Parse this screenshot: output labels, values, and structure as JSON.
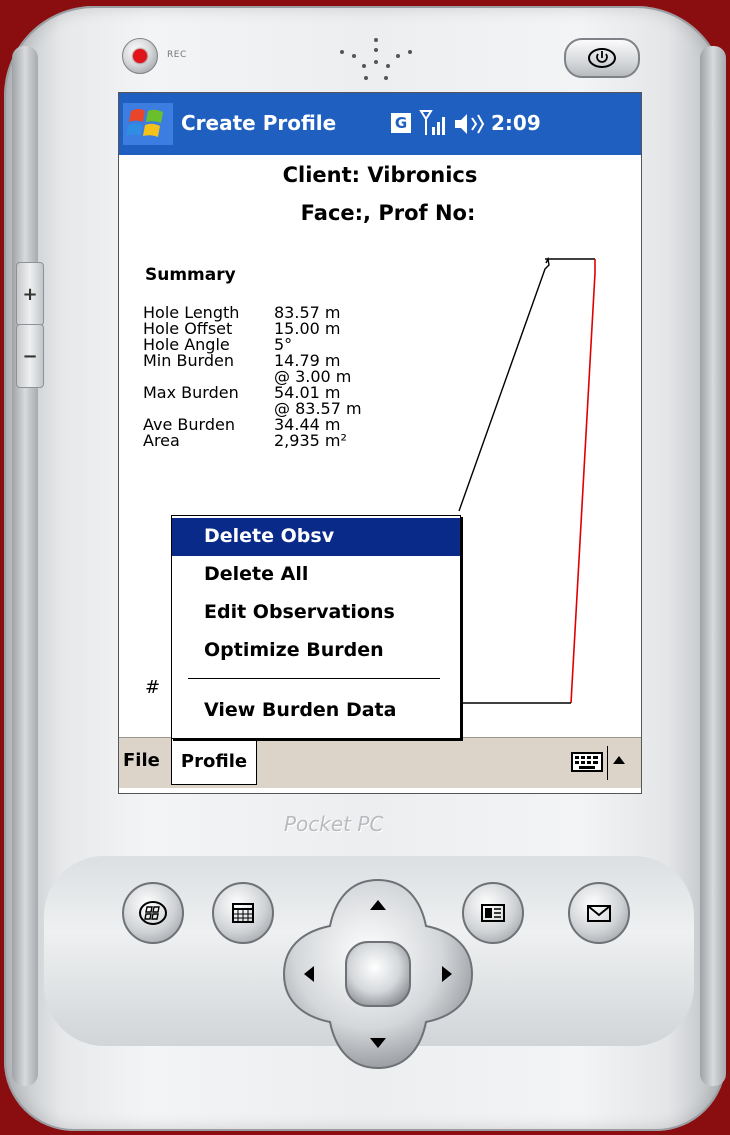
{
  "device": {
    "rec_label": "REC",
    "side_plus": "+",
    "side_minus": "−",
    "brand_label": "Pocket PC"
  },
  "taskbar": {
    "title": "Create Profile",
    "g_icon_label": "G",
    "time": "2:09",
    "icons": [
      "windows-start-icon",
      "g-icon",
      "signal-icon",
      "volume-icon"
    ]
  },
  "header": {
    "client": "Client: Vibronics",
    "face": "Face:, Prof No:"
  },
  "summary": {
    "title": "Summary",
    "rows": [
      {
        "label": "Hole Length",
        "value": "83.57 m"
      },
      {
        "label": "Hole Offset",
        "value": "15.00 m"
      },
      {
        "label": "Hole Angle",
        "value": "5°"
      },
      {
        "label": "Min Burden",
        "value": "14.79 m"
      },
      {
        "label": "",
        "value": " @ 3.00 m"
      },
      {
        "label": "Max Burden",
        "value": "54.01 m"
      },
      {
        "label": "",
        "value": " @ 83.57 m"
      },
      {
        "label": "Ave Burden",
        "value": "34.44 m"
      },
      {
        "label": "Area",
        "value": "2,935 m²"
      }
    ]
  },
  "hash_label": "#",
  "popup_menu": {
    "items": [
      {
        "label": "Delete Obsv",
        "selected": true
      },
      {
        "label": "Delete All",
        "selected": false
      },
      {
        "label": "Edit Observations",
        "selected": false
      },
      {
        "label": "Optimize Burden",
        "selected": false
      },
      {
        "label": "View Burden Data",
        "selected": false
      }
    ]
  },
  "menubar": {
    "file": "File",
    "profile": "Profile"
  },
  "colors": {
    "background": "#8a0e10",
    "taskbar": "#1f5fbf",
    "menu_selected": "#0a2a8a",
    "menubar": "#ddd4c9",
    "hole_line": "#e00000"
  }
}
